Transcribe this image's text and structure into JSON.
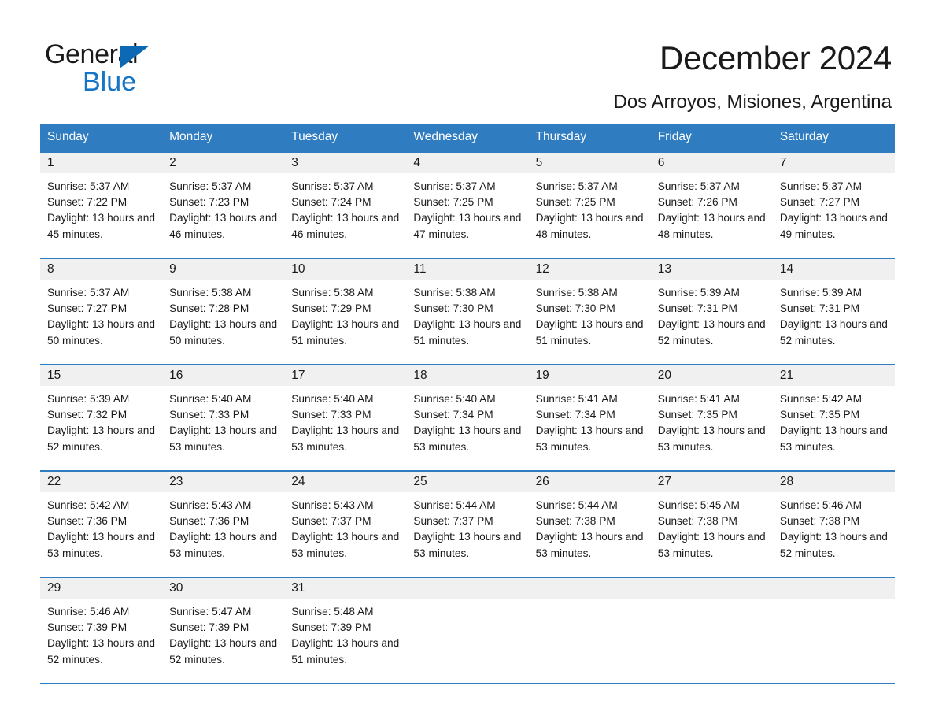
{
  "logo": {
    "word1": "General",
    "word2": "Blue",
    "triangle_color": "#0d69b4",
    "word2_color": "#1575c6"
  },
  "header": {
    "title": "December 2024",
    "subtitle": "Dos Arroyos, Misiones, Argentina"
  },
  "theme": {
    "header_blue": "#2f7cc0",
    "row_border_blue": "#2f7cc0",
    "daynum_band": "#f0f0f0",
    "text": "#1a1a1a"
  },
  "weekday_headers": [
    "Sunday",
    "Monday",
    "Tuesday",
    "Wednesday",
    "Thursday",
    "Friday",
    "Saturday"
  ],
  "labels": {
    "sunrise_prefix": "Sunrise:",
    "sunset_prefix": "Sunset:",
    "daylight_prefix": "Daylight:"
  },
  "weeks": [
    [
      {
        "day": "1",
        "sunrise": "Sunrise: 5:37 AM",
        "sunset": "Sunset: 7:22 PM",
        "daylight": "Daylight: 13 hours and 45 minutes."
      },
      {
        "day": "2",
        "sunrise": "Sunrise: 5:37 AM",
        "sunset": "Sunset: 7:23 PM",
        "daylight": "Daylight: 13 hours and 46 minutes."
      },
      {
        "day": "3",
        "sunrise": "Sunrise: 5:37 AM",
        "sunset": "Sunset: 7:24 PM",
        "daylight": "Daylight: 13 hours and 46 minutes."
      },
      {
        "day": "4",
        "sunrise": "Sunrise: 5:37 AM",
        "sunset": "Sunset: 7:25 PM",
        "daylight": "Daylight: 13 hours and 47 minutes."
      },
      {
        "day": "5",
        "sunrise": "Sunrise: 5:37 AM",
        "sunset": "Sunset: 7:25 PM",
        "daylight": "Daylight: 13 hours and 48 minutes."
      },
      {
        "day": "6",
        "sunrise": "Sunrise: 5:37 AM",
        "sunset": "Sunset: 7:26 PM",
        "daylight": "Daylight: 13 hours and 48 minutes."
      },
      {
        "day": "7",
        "sunrise": "Sunrise: 5:37 AM",
        "sunset": "Sunset: 7:27 PM",
        "daylight": "Daylight: 13 hours and 49 minutes."
      }
    ],
    [
      {
        "day": "8",
        "sunrise": "Sunrise: 5:37 AM",
        "sunset": "Sunset: 7:27 PM",
        "daylight": "Daylight: 13 hours and 50 minutes."
      },
      {
        "day": "9",
        "sunrise": "Sunrise: 5:38 AM",
        "sunset": "Sunset: 7:28 PM",
        "daylight": "Daylight: 13 hours and 50 minutes."
      },
      {
        "day": "10",
        "sunrise": "Sunrise: 5:38 AM",
        "sunset": "Sunset: 7:29 PM",
        "daylight": "Daylight: 13 hours and 51 minutes."
      },
      {
        "day": "11",
        "sunrise": "Sunrise: 5:38 AM",
        "sunset": "Sunset: 7:30 PM",
        "daylight": "Daylight: 13 hours and 51 minutes."
      },
      {
        "day": "12",
        "sunrise": "Sunrise: 5:38 AM",
        "sunset": "Sunset: 7:30 PM",
        "daylight": "Daylight: 13 hours and 51 minutes."
      },
      {
        "day": "13",
        "sunrise": "Sunrise: 5:39 AM",
        "sunset": "Sunset: 7:31 PM",
        "daylight": "Daylight: 13 hours and 52 minutes."
      },
      {
        "day": "14",
        "sunrise": "Sunrise: 5:39 AM",
        "sunset": "Sunset: 7:31 PM",
        "daylight": "Daylight: 13 hours and 52 minutes."
      }
    ],
    [
      {
        "day": "15",
        "sunrise": "Sunrise: 5:39 AM",
        "sunset": "Sunset: 7:32 PM",
        "daylight": "Daylight: 13 hours and 52 minutes."
      },
      {
        "day": "16",
        "sunrise": "Sunrise: 5:40 AM",
        "sunset": "Sunset: 7:33 PM",
        "daylight": "Daylight: 13 hours and 53 minutes."
      },
      {
        "day": "17",
        "sunrise": "Sunrise: 5:40 AM",
        "sunset": "Sunset: 7:33 PM",
        "daylight": "Daylight: 13 hours and 53 minutes."
      },
      {
        "day": "18",
        "sunrise": "Sunrise: 5:40 AM",
        "sunset": "Sunset: 7:34 PM",
        "daylight": "Daylight: 13 hours and 53 minutes."
      },
      {
        "day": "19",
        "sunrise": "Sunrise: 5:41 AM",
        "sunset": "Sunset: 7:34 PM",
        "daylight": "Daylight: 13 hours and 53 minutes."
      },
      {
        "day": "20",
        "sunrise": "Sunrise: 5:41 AM",
        "sunset": "Sunset: 7:35 PM",
        "daylight": "Daylight: 13 hours and 53 minutes."
      },
      {
        "day": "21",
        "sunrise": "Sunrise: 5:42 AM",
        "sunset": "Sunset: 7:35 PM",
        "daylight": "Daylight: 13 hours and 53 minutes."
      }
    ],
    [
      {
        "day": "22",
        "sunrise": "Sunrise: 5:42 AM",
        "sunset": "Sunset: 7:36 PM",
        "daylight": "Daylight: 13 hours and 53 minutes."
      },
      {
        "day": "23",
        "sunrise": "Sunrise: 5:43 AM",
        "sunset": "Sunset: 7:36 PM",
        "daylight": "Daylight: 13 hours and 53 minutes."
      },
      {
        "day": "24",
        "sunrise": "Sunrise: 5:43 AM",
        "sunset": "Sunset: 7:37 PM",
        "daylight": "Daylight: 13 hours and 53 minutes."
      },
      {
        "day": "25",
        "sunrise": "Sunrise: 5:44 AM",
        "sunset": "Sunset: 7:37 PM",
        "daylight": "Daylight: 13 hours and 53 minutes."
      },
      {
        "day": "26",
        "sunrise": "Sunrise: 5:44 AM",
        "sunset": "Sunset: 7:38 PM",
        "daylight": "Daylight: 13 hours and 53 minutes."
      },
      {
        "day": "27",
        "sunrise": "Sunrise: 5:45 AM",
        "sunset": "Sunset: 7:38 PM",
        "daylight": "Daylight: 13 hours and 53 minutes."
      },
      {
        "day": "28",
        "sunrise": "Sunrise: 5:46 AM",
        "sunset": "Sunset: 7:38 PM",
        "daylight": "Daylight: 13 hours and 52 minutes."
      }
    ],
    [
      {
        "day": "29",
        "sunrise": "Sunrise: 5:46 AM",
        "sunset": "Sunset: 7:39 PM",
        "daylight": "Daylight: 13 hours and 52 minutes."
      },
      {
        "day": "30",
        "sunrise": "Sunrise: 5:47 AM",
        "sunset": "Sunset: 7:39 PM",
        "daylight": "Daylight: 13 hours and 52 minutes."
      },
      {
        "day": "31",
        "sunrise": "Sunrise: 5:48 AM",
        "sunset": "Sunset: 7:39 PM",
        "daylight": "Daylight: 13 hours and 51 minutes."
      },
      {
        "day": "",
        "sunrise": "",
        "sunset": "",
        "daylight": ""
      },
      {
        "day": "",
        "sunrise": "",
        "sunset": "",
        "daylight": ""
      },
      {
        "day": "",
        "sunrise": "",
        "sunset": "",
        "daylight": ""
      },
      {
        "day": "",
        "sunrise": "",
        "sunset": "",
        "daylight": ""
      }
    ]
  ]
}
